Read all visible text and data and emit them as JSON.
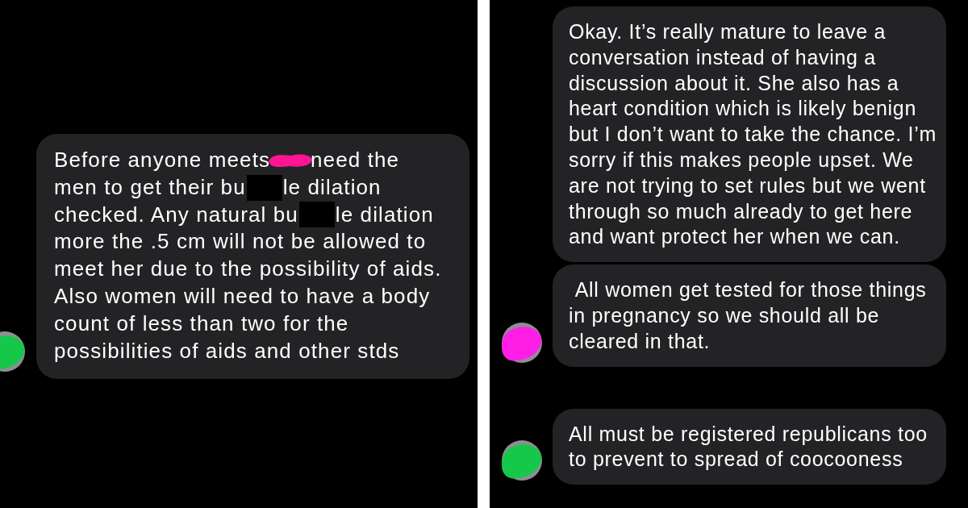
{
  "panels": [
    {
      "messages": [
        {
          "kind": "redacted",
          "avatar": {
            "color": "#16c84a"
          },
          "lines": [
            [
              {
                "kind": "text",
                "text": "Before anyone meets"
              },
              {
                "kind": "scribble",
                "color": "#ff1493"
              },
              {
                "kind": "text",
                "text": "need the"
              }
            ],
            [
              {
                "kind": "text",
                "text": "men to get their bu"
              },
              {
                "kind": "block"
              },
              {
                "kind": "text",
                "text": "le dilation"
              }
            ],
            [
              {
                "kind": "text",
                "text": "checked. Any natural bu"
              },
              {
                "kind": "block"
              },
              {
                "kind": "text",
                "text": "le dilation"
              }
            ],
            [
              {
                "kind": "text",
                "text": "more the .5 cm will not be allowed to"
              }
            ],
            [
              {
                "kind": "text",
                "text": "meet her due to the possibility of aids."
              }
            ],
            [
              {
                "kind": "text",
                "text": "Also women will need to have a body"
              }
            ],
            [
              {
                "kind": "text",
                "text": "count of less than two for the"
              }
            ],
            [
              {
                "kind": "text",
                "text": "possibilities of aids and other stds"
              }
            ]
          ]
        }
      ]
    },
    {
      "messages": [
        {
          "kind": "plain",
          "text": "Okay. It’s really mature to leave a conversation instead of having a discussion about it. She also has a heart condition which is likely benign but I don’t want to take the chance. I’m sorry if this makes people upset. We are not trying to set rules but we went through so much already to get here and want protect her when we can."
        },
        {
          "kind": "plain",
          "avatar": {
            "color": "#ff1ee6"
          },
          "text": " All women get tested for those things in pregnancy so we should all be cleared in that."
        },
        {
          "kind": "plain",
          "avatar": {
            "color": "#16c84a"
          },
          "text": "All must be registered republicans too to prevent to spread of coocooness"
        }
      ]
    }
  ]
}
